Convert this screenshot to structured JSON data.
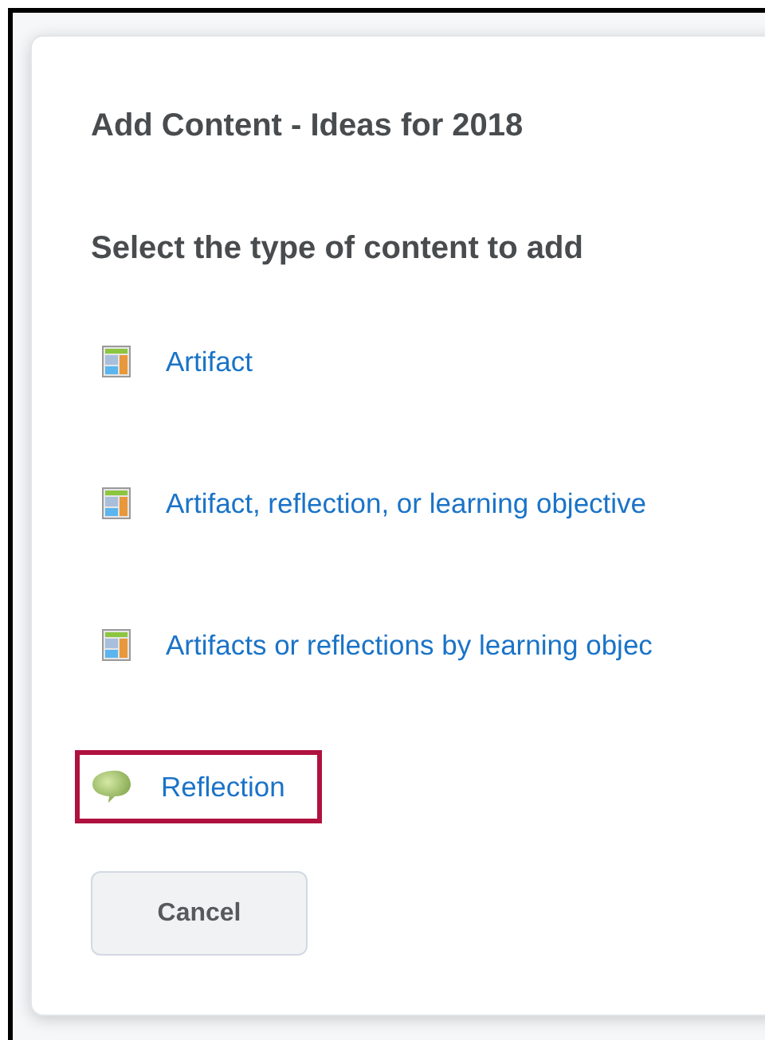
{
  "dialog": {
    "title": "Add Content - Ideas for 2018",
    "prompt": "Select the type of content to add",
    "options": [
      {
        "kind": "artifact",
        "label": "Artifact",
        "highlighted": false
      },
      {
        "kind": "artifact",
        "label": "Artifact, reflection, or learning objective",
        "highlighted": false
      },
      {
        "kind": "artifact",
        "label": "Artifacts or reflections by learning objec",
        "highlighted": false
      },
      {
        "kind": "reflection",
        "label": "Reflection",
        "highlighted": true
      }
    ],
    "buttons": [
      "Cancel"
    ]
  }
}
